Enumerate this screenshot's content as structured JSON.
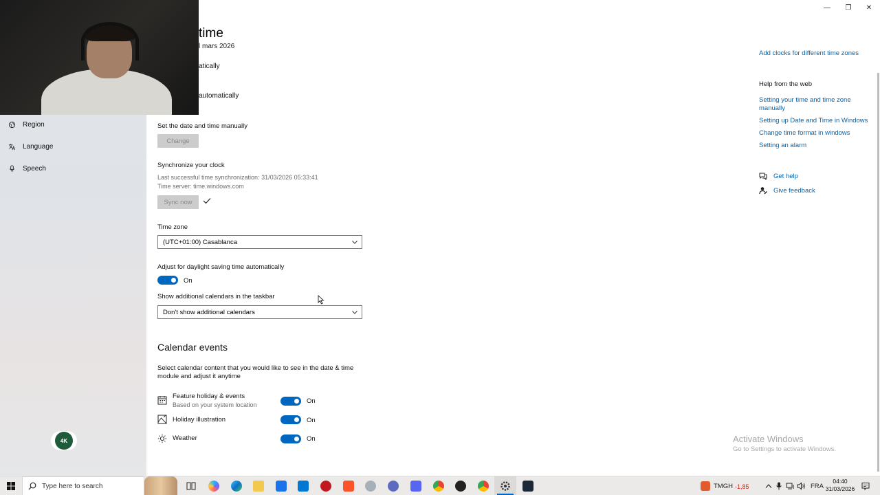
{
  "window": {
    "minimize_label": "—",
    "restore_label": "❐",
    "close_label": "✕"
  },
  "page": {
    "title_fragment": "time",
    "date_fragment": "l mars 2026",
    "fragment_automatically_1": "atically",
    "fragment_automatically_2": "automatically"
  },
  "sidebar": {
    "items": [
      {
        "label": "Region",
        "icon": "region-icon"
      },
      {
        "label": "Language",
        "icon": "language-icon"
      },
      {
        "label": "Speech",
        "icon": "speech-icon"
      }
    ],
    "badge_text": "4K"
  },
  "manual": {
    "label": "Set the date and time manually",
    "button": "Change"
  },
  "sync": {
    "heading": "Synchronize your clock",
    "last_sync": "Last successful time synchronization: 31/03/2026 05:33:41",
    "server": "Time server: time.windows.com",
    "button": "Sync now"
  },
  "timezone": {
    "label": "Time zone",
    "value": "(UTC+01:00) Casablanca"
  },
  "dst": {
    "label": "Adjust for daylight saving time automatically",
    "state": "On"
  },
  "calendars": {
    "label": "Show additional calendars in the taskbar",
    "value": "Don't show additional calendars"
  },
  "calendar_events": {
    "title": "Calendar events",
    "description_line1": "Select calendar content that you would like to see in the date & time",
    "description_line2": "module and adjust it anytime",
    "items": [
      {
        "label": "Feature holiday & events",
        "sub": "Based on your system location",
        "state": "On"
      },
      {
        "label": "Holiday illustration",
        "sub": "",
        "state": "On"
      },
      {
        "label": "Weather",
        "sub": "",
        "state": "On"
      }
    ]
  },
  "right": {
    "add_clocks": "Add clocks for different time zones",
    "help_heading": "Help from the web",
    "help_link1_line1": "Setting your time and time zone",
    "help_link1_line2": "manually",
    "help_link2": "Setting up Date and Time in Windows",
    "help_link3": "Change time format in windows",
    "help_link4": "Setting an alarm",
    "get_help": "Get help",
    "give_feedback": "Give feedback"
  },
  "watermark": {
    "line1": "Activate Windows",
    "line2": "Go to Settings to activate Windows."
  },
  "taskbar": {
    "search_placeholder": "Type here to search",
    "stock_name": "TMGH",
    "stock_change": "-1,85",
    "language": "FRA",
    "time": "04:40",
    "date": "31/03/2026"
  },
  "colors": {
    "accent": "#0067c0",
    "link": "#0063b1"
  }
}
